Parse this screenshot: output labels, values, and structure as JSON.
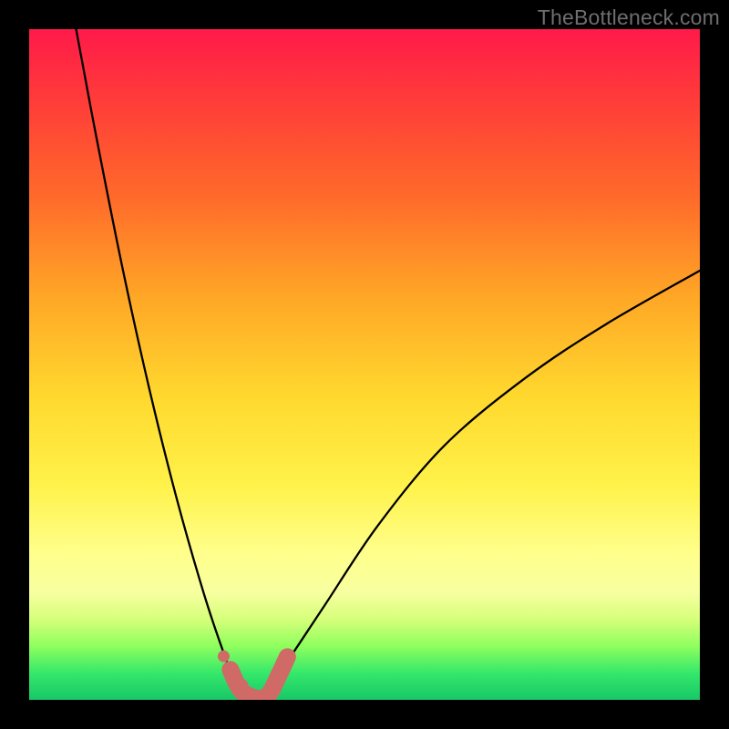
{
  "watermark": "TheBottleneck.com",
  "chart_data": {
    "type": "line",
    "title": "",
    "xlabel": "",
    "ylabel": "",
    "xlim": [
      0,
      100
    ],
    "ylim": [
      0,
      100
    ],
    "legend": false,
    "grid": false,
    "annotations": [],
    "description": "Bottleneck curve on a vertical green-to-red gradient. No axis ticks or labels are shown. Minimum of the curve lies near x≈33 at y≈0; both branches rise steeply, left branch to y≈100, right branch to y≈64 at x=100.",
    "series": [
      {
        "name": "bottleneck-curve",
        "x": [
          7,
          10,
          14,
          18,
          22,
          26,
          29,
          31,
          33,
          35,
          38,
          44,
          52,
          62,
          74,
          86,
          100
        ],
        "y": [
          100,
          84,
          64,
          46,
          30,
          16,
          7,
          2,
          0,
          1,
          5,
          14,
          26,
          38,
          48,
          56,
          64
        ]
      }
    ],
    "overlay_segments": {
      "color": "#cf6a66",
      "note": "thick salmon segment drawn over the curve around the valley",
      "dots_x": [
        29,
        31.5
      ],
      "dots_y": [
        6.5,
        2
      ],
      "thick_path_x": [
        30,
        31.5,
        33.5,
        35,
        36,
        37,
        38.5
      ],
      "thick_path_y": [
        4.5,
        1.5,
        0.3,
        0.3,
        1.2,
        3.2,
        6.4
      ]
    }
  }
}
